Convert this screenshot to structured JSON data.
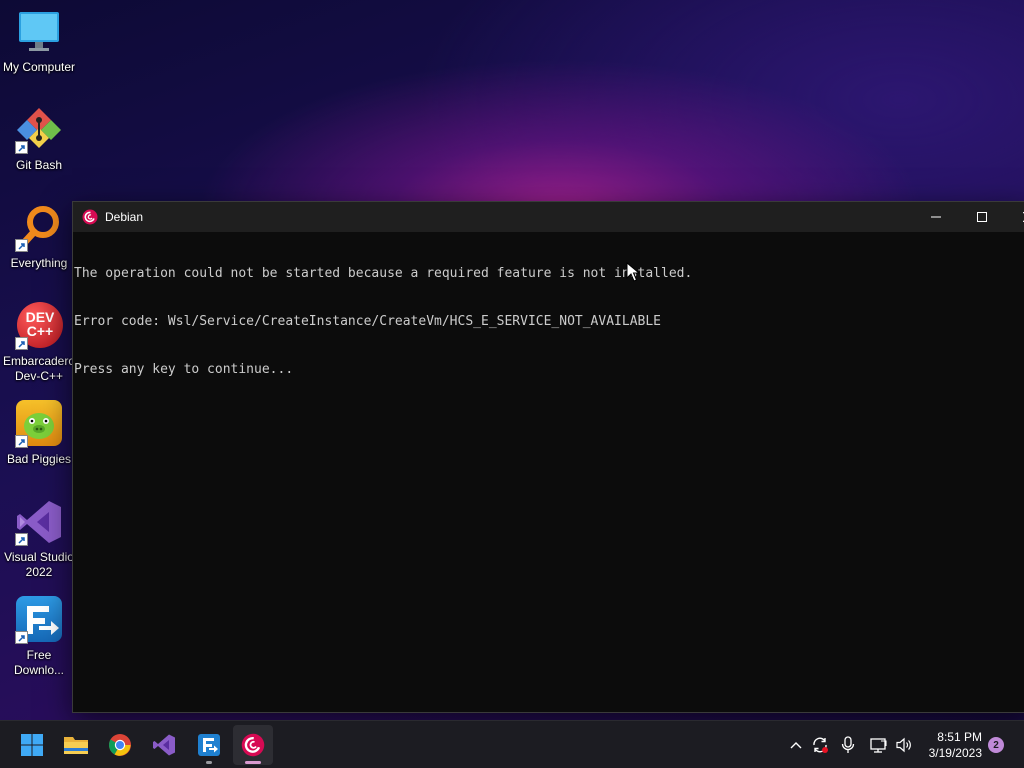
{
  "desktop": {
    "icons": [
      {
        "label": "My Computer",
        "icon": "monitor-icon"
      },
      {
        "label": "Git Bash",
        "icon": "git-bash-icon"
      },
      {
        "label": "Everything",
        "icon": "everything-search-icon"
      },
      {
        "label": "Embarcadero\nDev-C++",
        "icon": "devcpp-icon",
        "glyph_text": "DEV\nC++"
      },
      {
        "label": "Bad Piggies",
        "icon": "bad-piggies-icon"
      },
      {
        "label": "Visual Studio\n2022",
        "icon": "visual-studio-icon"
      },
      {
        "label": "Free\nDownlo...",
        "icon": "free-download-manager-icon"
      }
    ]
  },
  "terminal": {
    "title": "Debian",
    "lines": [
      "The operation could not be started because a required feature is not installed.",
      "Error code: Wsl/Service/CreateInstance/CreateVm/HCS_E_SERVICE_NOT_AVAILABLE",
      "Press any key to continue..."
    ]
  },
  "taskbar": {
    "apps": [
      {
        "name": "Start",
        "icon": "windows-start-icon"
      },
      {
        "name": "File Explorer",
        "icon": "folder-icon"
      },
      {
        "name": "Google Chrome",
        "icon": "chrome-icon"
      },
      {
        "name": "Visual Studio",
        "icon": "visual-studio-icon"
      },
      {
        "name": "Free Download Manager",
        "icon": "free-download-manager-icon"
      },
      {
        "name": "Debian",
        "icon": "debian-icon"
      }
    ],
    "clock": {
      "time": "8:51 PM",
      "date": "3/19/2023"
    },
    "notification_count": "2"
  },
  "colors": {
    "terminal_bg": "#0c0c0c",
    "terminal_text": "#cccccc",
    "debian_red": "#d70a53",
    "taskbar_bg": "#1c1c22"
  }
}
